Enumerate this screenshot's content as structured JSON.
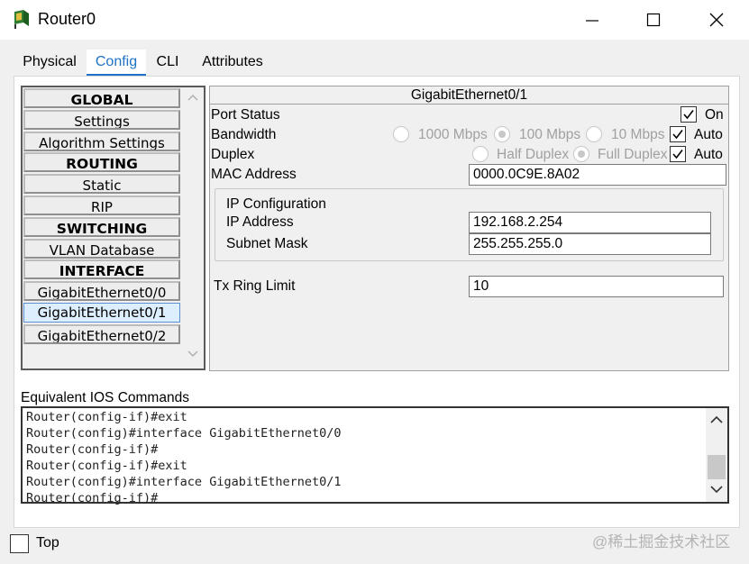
{
  "window": {
    "title": "Router0",
    "icon": "router-icon",
    "controls": [
      "minimize-icon",
      "maximize-icon",
      "close-icon"
    ]
  },
  "tabs": [
    {
      "label": "Physical",
      "active": false
    },
    {
      "label": "Config",
      "active": true
    },
    {
      "label": "CLI",
      "active": false
    },
    {
      "label": "Attributes",
      "active": false
    }
  ],
  "nav": {
    "items": [
      {
        "label": "GLOBAL",
        "type": "header"
      },
      {
        "label": "Settings",
        "type": "item"
      },
      {
        "label": "Algorithm Settings",
        "type": "item"
      },
      {
        "label": "ROUTING",
        "type": "header"
      },
      {
        "label": "Static",
        "type": "item"
      },
      {
        "label": "RIP",
        "type": "item"
      },
      {
        "label": "SWITCHING",
        "type": "header"
      },
      {
        "label": "VLAN Database",
        "type": "item"
      },
      {
        "label": "INTERFACE",
        "type": "header"
      },
      {
        "label": "GigabitEthernet0/0",
        "type": "item"
      },
      {
        "label": "GigabitEthernet0/1",
        "type": "item",
        "selected": true
      },
      {
        "label": "GigabitEthernet0/2",
        "type": "item"
      }
    ]
  },
  "interface": {
    "title": "GigabitEthernet0/1",
    "port_status": {
      "label": "Port Status",
      "on_label": "On",
      "on": true
    },
    "bandwidth": {
      "label": "Bandwidth",
      "options": [
        "1000 Mbps",
        "100 Mbps",
        "10 Mbps"
      ],
      "selected": "100 Mbps",
      "auto_label": "Auto",
      "auto": true
    },
    "duplex": {
      "label": "Duplex",
      "options": [
        "Half Duplex",
        "Full Duplex"
      ],
      "selected": "Full Duplex",
      "auto_label": "Auto",
      "auto": true
    },
    "mac": {
      "label": "MAC Address",
      "value": "0000.0C9E.8A02"
    },
    "ip_config": {
      "heading": "IP Configuration",
      "ip_label": "IP Address",
      "ip_value": "192.168.2.254",
      "mask_label": "Subnet Mask",
      "mask_value": "255.255.255.0"
    },
    "tx_ring": {
      "label": "Tx Ring Limit",
      "value": "10"
    }
  },
  "ios": {
    "label": "Equivalent IOS Commands",
    "lines": [
      "Router(config-if)#exit",
      "Router(config)#interface GigabitEthernet0/0",
      "Router(config-if)#",
      "Router(config-if)#exit",
      "Router(config)#interface GigabitEthernet0/1",
      "Router(config-if)#"
    ]
  },
  "footer": {
    "top_label": "Top",
    "top_checked": false
  },
  "watermark": "@稀土掘金技术社区"
}
